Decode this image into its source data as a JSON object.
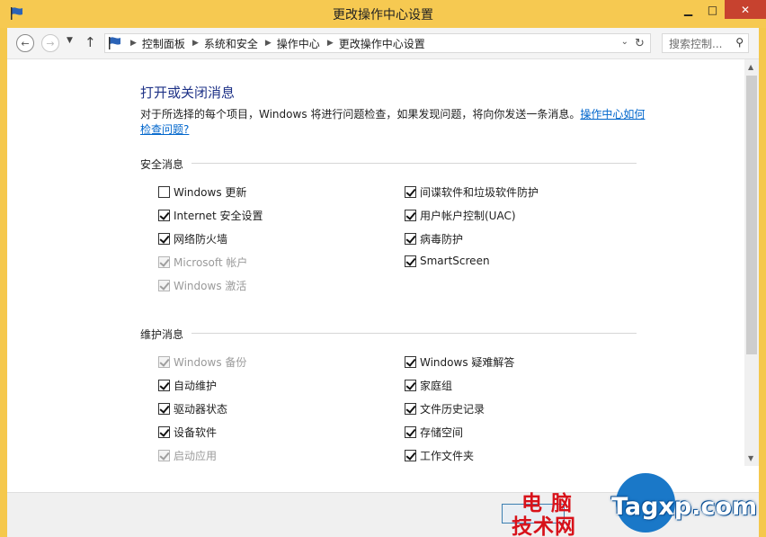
{
  "window": {
    "title": "更改操作中心设置",
    "minimize": "▁",
    "maximize": "□",
    "close": "✕"
  },
  "nav": {
    "breadcrumbs": [
      "控制面板",
      "系统和安全",
      "操作中心",
      "更改操作中心设置"
    ],
    "search_placeholder": "搜索控制..."
  },
  "main": {
    "heading": "打开或关闭消息",
    "description": "对于所选择的每个项目，Windows 将进行问题检查，如果发现问题，将向你发送一条消息。",
    "help_link": "操作中心如何检查问题?",
    "security": {
      "label": "安全消息",
      "left": [
        {
          "label": "Windows 更新",
          "checked": false,
          "disabled": false
        },
        {
          "label": "Internet 安全设置",
          "checked": true,
          "disabled": false
        },
        {
          "label": "网络防火墙",
          "checked": true,
          "disabled": false
        },
        {
          "label": "Microsoft 帐户",
          "checked": true,
          "disabled": true
        },
        {
          "label": "Windows 激活",
          "checked": true,
          "disabled": true
        }
      ],
      "right": [
        {
          "label": "间谍软件和垃圾软件防护",
          "checked": true,
          "disabled": false
        },
        {
          "label": "用户帐户控制(UAC)",
          "checked": true,
          "disabled": false
        },
        {
          "label": "病毒防护",
          "checked": true,
          "disabled": false
        },
        {
          "label": "SmartScreen",
          "checked": true,
          "disabled": false
        }
      ]
    },
    "maintenance": {
      "label": "维护消息",
      "left": [
        {
          "label": "Windows 备份",
          "checked": true,
          "disabled": true
        },
        {
          "label": "自动维护",
          "checked": true,
          "disabled": false
        },
        {
          "label": "驱动器状态",
          "checked": true,
          "disabled": false
        },
        {
          "label": "设备软件",
          "checked": true,
          "disabled": false
        },
        {
          "label": "启动应用",
          "checked": true,
          "disabled": true
        }
      ],
      "right": [
        {
          "label": "Windows 疑难解答",
          "checked": true,
          "disabled": false
        },
        {
          "label": "家庭组",
          "checked": true,
          "disabled": false
        },
        {
          "label": "文件历史记录",
          "checked": true,
          "disabled": false
        },
        {
          "label": "存储空间",
          "checked": true,
          "disabled": false
        },
        {
          "label": "工作文件夹",
          "checked": true,
          "disabled": false
        }
      ]
    }
  },
  "watermark": {
    "line1": "电脑",
    "line2": "技术网",
    "site": "Tagxp.com"
  }
}
